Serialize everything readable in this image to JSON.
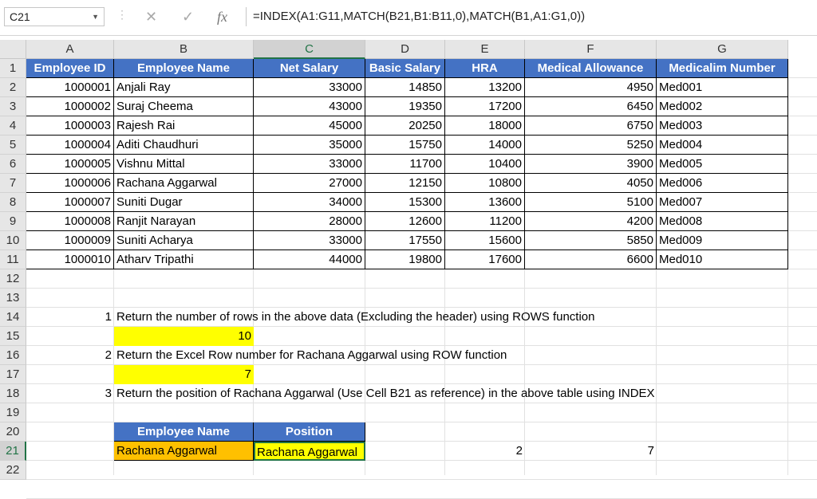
{
  "name_box": "C21",
  "formula_bar": {
    "fx_label": "fx",
    "formula": "=INDEX(A1:G11,MATCH(B21,B1:B11,0),MATCH(B1,A1:G1,0))"
  },
  "columns": [
    "A",
    "B",
    "C",
    "D",
    "E",
    "F",
    "G"
  ],
  "rows": [
    "1",
    "2",
    "3",
    "4",
    "5",
    "6",
    "7",
    "8",
    "9",
    "10",
    "11",
    "12",
    "13",
    "14",
    "15",
    "16",
    "17",
    "18",
    "19",
    "20",
    "21",
    "22"
  ],
  "table": {
    "headers": [
      "Employee ID",
      "Employee Name",
      "Net Salary",
      "Basic Salary",
      "HRA",
      "Medical Allowance",
      "Medicalim Number"
    ],
    "rows": [
      [
        "1000001",
        "Anjali Ray",
        "33000",
        "14850",
        "13200",
        "4950",
        "Med001"
      ],
      [
        "1000002",
        "Suraj Cheema",
        "43000",
        "19350",
        "17200",
        "6450",
        "Med002"
      ],
      [
        "1000003",
        "Rajesh Rai",
        "45000",
        "20250",
        "18000",
        "6750",
        "Med003"
      ],
      [
        "1000004",
        "Aditi Chaudhuri",
        "35000",
        "15750",
        "14000",
        "5250",
        "Med004"
      ],
      [
        "1000005",
        "Vishnu Mittal",
        "33000",
        "11700",
        "10400",
        "3900",
        "Med005"
      ],
      [
        "1000006",
        "Rachana Aggarwal",
        "27000",
        "12150",
        "10800",
        "4050",
        "Med006"
      ],
      [
        "1000007",
        "Suniti Dugar",
        "34000",
        "15300",
        "13600",
        "5100",
        "Med007"
      ],
      [
        "1000008",
        "Ranjit Narayan",
        "28000",
        "12600",
        "11200",
        "4200",
        "Med008"
      ],
      [
        "1000009",
        "Suniti Acharya",
        "33000",
        "17550",
        "15600",
        "5850",
        "Med009"
      ],
      [
        "1000010",
        "Atharv Tripathi",
        "44000",
        "19800",
        "17600",
        "6600",
        "Med010"
      ]
    ]
  },
  "questions": [
    {
      "num": "1",
      "text": "Return the number of rows in the above data (Excluding the header) using ROWS function",
      "answer": "10"
    },
    {
      "num": "2",
      "text": "Return the Excel Row number for Rachana Aggarwal using ROW function",
      "answer": "7"
    },
    {
      "num": "3",
      "text": "Return the position of Rachana Aggarwal (Use Cell B21 as reference) in the above table using INDEX"
    }
  ],
  "lookup": {
    "header_name": "Employee Name",
    "header_position": "Position",
    "name_value": "Rachana Aggarwal",
    "position_value": "Rachana Aggarwal",
    "e21": "2",
    "f21": "7"
  },
  "colors": {
    "header_blue": "#4472c4",
    "yellow": "#ffff00",
    "orange": "#ffc000",
    "excel_green": "#217346"
  }
}
